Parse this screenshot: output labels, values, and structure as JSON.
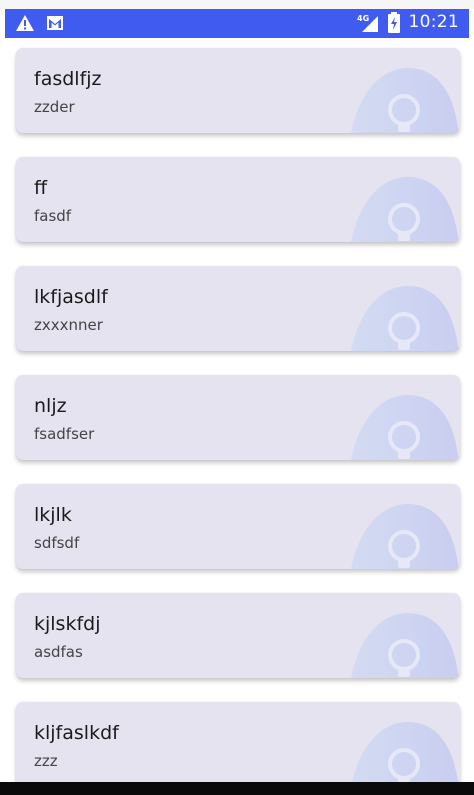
{
  "status_bar": {
    "left_icons": [
      "warning-icon",
      "gmail-icon"
    ],
    "network": "4G",
    "time": "10:21",
    "bg_color": "#3f5bf0"
  },
  "cards": [
    {
      "title": "fasdlfjz",
      "subtitle": "zzder"
    },
    {
      "title": "ff",
      "subtitle": "fasdf"
    },
    {
      "title": "lkfjasdlf",
      "subtitle": "zxxxnner"
    },
    {
      "title": "nljz",
      "subtitle": "fsadfser"
    },
    {
      "title": "lkjlk",
      "subtitle": "sdfsdf"
    },
    {
      "title": "kjlskfdj",
      "subtitle": "asdfas"
    },
    {
      "title": "kljfaslkdf",
      "subtitle": "zzz"
    }
  ],
  "colors": {
    "card_bg": "#e5e3f0",
    "blob": "#c9cdf0",
    "bulb": "#e6e8f7"
  }
}
